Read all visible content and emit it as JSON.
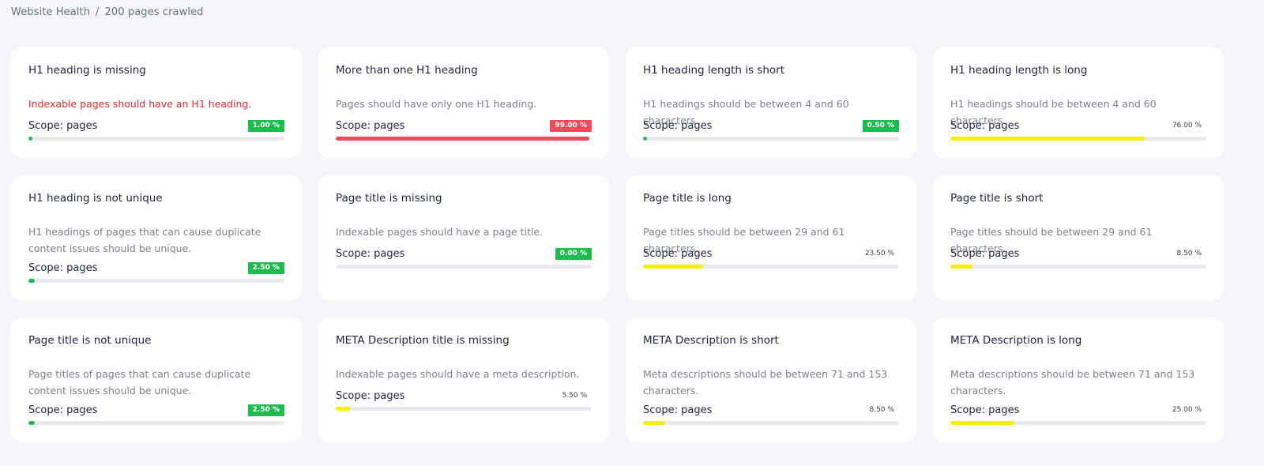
{
  "breadcrumb": {
    "root": "Website Health",
    "separator": "/",
    "current": "200 pages crawled"
  },
  "colors": {
    "green": "#1fbb51",
    "red": "#ef4b5b",
    "yellow": "#f5ef05",
    "track": "#e8eaef"
  },
  "cards": [
    {
      "title": "H1 heading is missing",
      "desc": "Indexable pages should have an H1 heading.",
      "alert": true,
      "scope": "Scope: pages",
      "pct_label": "1.00 %",
      "value": 0.01,
      "style": "green"
    },
    {
      "title": "More than one H1 heading",
      "desc": "Pages should have only one H1 heading.",
      "alert": false,
      "scope": "Scope: pages",
      "pct_label": "99.00 %",
      "value": 0.99,
      "style": "red"
    },
    {
      "title": "H1 heading length is short",
      "desc": "H1 headings should be between 4 and 60 characters.",
      "alert": false,
      "scope": "Scope: pages",
      "pct_label": "0.50 %",
      "value": 0.005,
      "style": "green"
    },
    {
      "title": "H1 heading length is long",
      "desc": "H1 headings should be between 4 and 60 characters.",
      "alert": false,
      "scope": "Scope: pages",
      "pct_label": "76.00 %",
      "value": 0.76,
      "style": "yellow"
    },
    {
      "title": "H1 heading is not unique",
      "desc": "H1 headings of pages that can cause duplicate content issues should be unique.",
      "alert": false,
      "scope": "Scope: pages",
      "pct_label": "2.50 %",
      "value": 0.025,
      "style": "green"
    },
    {
      "title": "Page title is missing",
      "desc": "Indexable pages should have a page title.",
      "alert": false,
      "scope": "Scope: pages",
      "pct_label": "0.00 %",
      "value": 0.0,
      "style": "green"
    },
    {
      "title": "Page title is long",
      "desc": "Page titles should be between 29 and 61 characters.",
      "alert": false,
      "scope": "Scope: pages",
      "pct_label": "23.50 %",
      "value": 0.235,
      "style": "yellow"
    },
    {
      "title": "Page title is short",
      "desc": "Page titles should be between 29 and 61 characters.",
      "alert": false,
      "scope": "Scope: pages",
      "pct_label": "8.50 %",
      "value": 0.085,
      "style": "yellow"
    },
    {
      "title": "Page title is not unique",
      "desc": "Page titles of pages that can cause duplicate content issues should be unique.",
      "alert": false,
      "scope": "Scope: pages",
      "pct_label": "2.50 %",
      "value": 0.025,
      "style": "green"
    },
    {
      "title": "META Description title is missing",
      "desc": "Indexable pages should have a meta description.",
      "alert": false,
      "scope": "Scope: pages",
      "pct_label": "5.50 %",
      "value": 0.055,
      "style": "yellow"
    },
    {
      "title": "META Description is short",
      "desc": "Meta descriptions should be between 71 and 153 characters.",
      "alert": false,
      "scope": "Scope: pages",
      "pct_label": "8.50 %",
      "value": 0.085,
      "style": "yellow"
    },
    {
      "title": "META Description is long",
      "desc": "Meta descriptions should be between 71 and 153 characters.",
      "alert": false,
      "scope": "Scope: pages",
      "pct_label": "25.00 %",
      "value": 0.25,
      "style": "yellow"
    }
  ]
}
